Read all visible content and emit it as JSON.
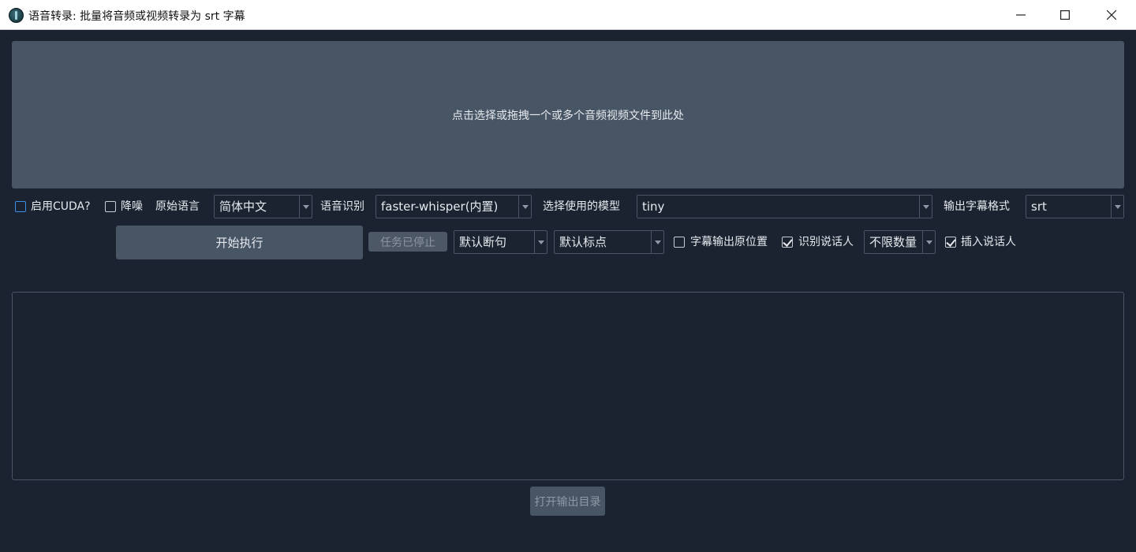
{
  "window": {
    "title": "语音转录: 批量将音频或视频转录为 srt 字幕",
    "icon": "app-logo-icon",
    "controls": [
      "minimize-icon",
      "maximize-icon",
      "close-icon"
    ]
  },
  "drop_zone": {
    "text": "点击选择或拖拽一个或多个音频视频文件到此处"
  },
  "options_row1": {
    "cuda_label": "启用CUDA?",
    "cuda_checked": false,
    "denoise_label": "降噪",
    "denoise_checked": false,
    "source_lang_label": "原始语言",
    "source_lang_value": "简体中文",
    "asr_label": "语音识别",
    "asr_value": "faster-whisper(内置)",
    "model_label": "选择使用的模型",
    "model_value": "tiny",
    "format_label": "输出字幕格式",
    "format_value": "srt"
  },
  "options_row2": {
    "start_label": "开始执行",
    "stopped_label": "任务已停止",
    "split_value": "默认断句",
    "punct_value": "默认标点",
    "keep_pos_label": "字幕输出原位置",
    "keep_pos_checked": false,
    "speaker_label": "识别说话人",
    "speaker_checked": true,
    "speaker_count_value": "不限数量",
    "insert_speaker_label": "插入说话人",
    "insert_speaker_checked": true
  },
  "log": {
    "text": ""
  },
  "footer": {
    "open_dir_label": "打开输出目录"
  },
  "colors": {
    "background": "#1b2330",
    "panel": "#475565",
    "border": "#4a5565",
    "accent": "#3a8ee6"
  }
}
